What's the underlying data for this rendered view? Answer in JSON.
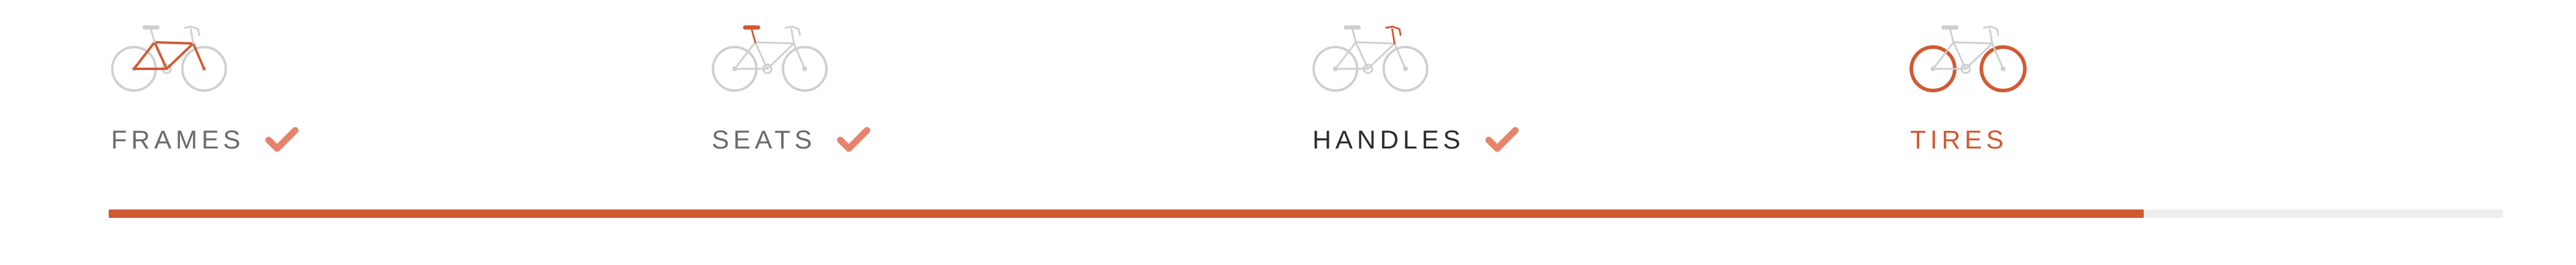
{
  "colors": {
    "accent": "#d15a33",
    "check": "#e6836a",
    "inactive_icon": "#cfcfcf",
    "completed_label": "#6b6b6b",
    "current_label": "#2b2b2b",
    "track": "#eeeeee"
  },
  "steps": [
    {
      "label": "FRAMES",
      "icon": "bicycle-frame-icon",
      "state": "completed",
      "highlight": "frame"
    },
    {
      "label": "SEATS",
      "icon": "bicycle-seat-icon",
      "state": "completed",
      "highlight": "seat"
    },
    {
      "label": "HANDLES",
      "icon": "bicycle-handlebar-icon",
      "state": "completed-current",
      "highlight": "handle"
    },
    {
      "label": "TIRES",
      "icon": "bicycle-tires-icon",
      "state": "active",
      "highlight": "tires"
    }
  ],
  "progress": {
    "fraction": 0.85
  }
}
